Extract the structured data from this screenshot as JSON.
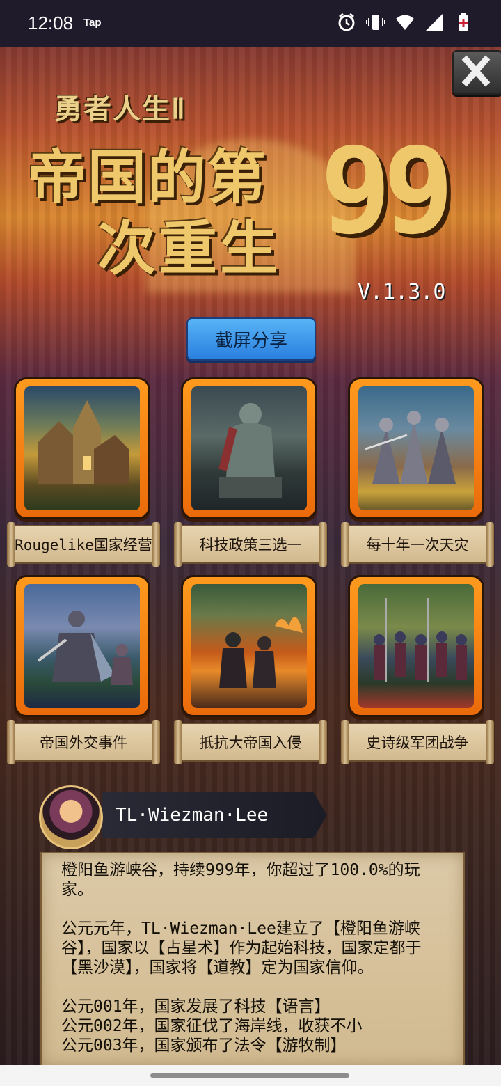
{
  "status": {
    "time": "12:08",
    "carrier": "Tap"
  },
  "title": {
    "subtitle": "勇者人生Ⅱ",
    "line1": "帝国的第",
    "line2": "次重生",
    "number": "99",
    "version": "V.1.3.0"
  },
  "share_label": "截屏分享",
  "features": [
    {
      "label": "Rougelike国家经营",
      "icon": "village-icon"
    },
    {
      "label": "科技政策三选一",
      "icon": "statue-icon"
    },
    {
      "label": "每十年一次天灾",
      "icon": "knights-battle-icon"
    },
    {
      "label": "帝国外交事件",
      "icon": "knight-duel-icon"
    },
    {
      "label": "抵抗大帝国入侵",
      "icon": "burning-city-icon"
    },
    {
      "label": "史诗级军团战争",
      "icon": "army-march-icon"
    }
  ],
  "player": {
    "name": "TL·Wiezman·Lee"
  },
  "story": "橙阳鱼游峡谷，持续999年，你超过了100.0%的玩家。\n\n公元元年，TL·Wiezman·Lee建立了【橙阳鱼游峡谷】，国家以【占星术】作为起始科技，国家定都于【黑沙漠】，国家将【道教】定为国家信仰。\n\n公元001年，国家发展了科技【语言】\n公元002年，国家征伐了海岸线，收获不小\n公元003年，国家颁布了法令【游牧制】"
}
